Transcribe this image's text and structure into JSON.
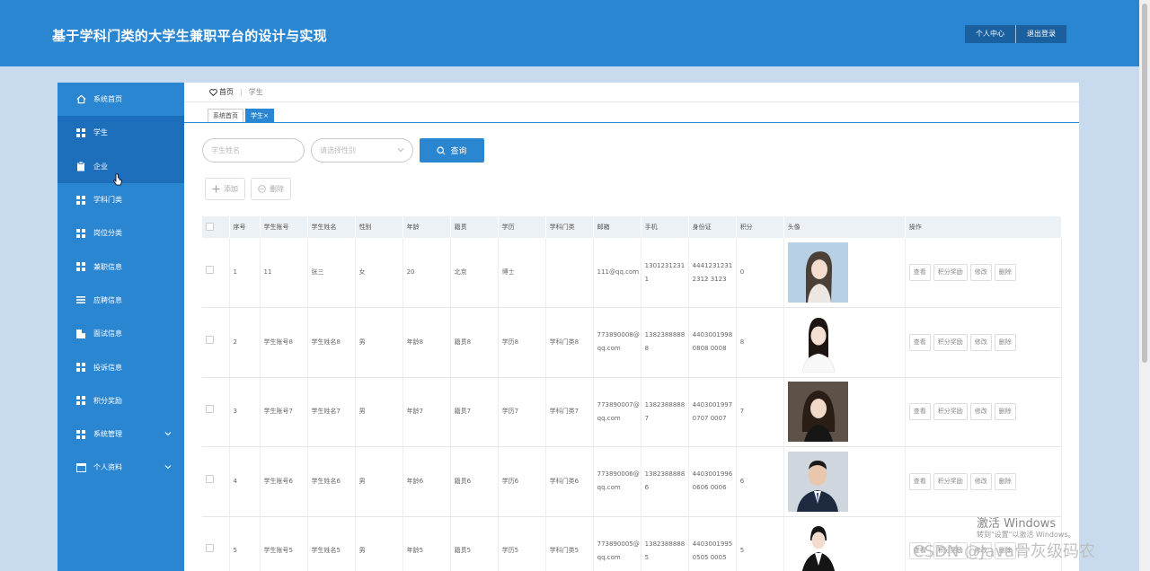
{
  "header": {
    "title": "基于学科门类的大学生兼职平台的设计与实现",
    "buttons": [
      "个人中心",
      "退出登录"
    ]
  },
  "sidebar": {
    "items": [
      {
        "label": "系统首页",
        "icon": "home-icon"
      },
      {
        "label": "学生",
        "icon": "grid-icon"
      },
      {
        "label": "企业",
        "icon": "clipboard-icon"
      },
      {
        "label": "学科门类",
        "icon": "grid-icon"
      },
      {
        "label": "岗位分类",
        "icon": "grid-icon"
      },
      {
        "label": "兼职信息",
        "icon": "grid-icon"
      },
      {
        "label": "应聘信息",
        "icon": "list-icon"
      },
      {
        "label": "面试信息",
        "icon": "note-icon"
      },
      {
        "label": "投诉信息",
        "icon": "grid-icon"
      },
      {
        "label": "积分奖励",
        "icon": "grid-icon"
      },
      {
        "label": "系统管理",
        "icon": "grid-icon",
        "expandable": true
      },
      {
        "label": "个人资料",
        "icon": "card-icon",
        "expandable": true
      }
    ],
    "accent": "#2b86d2"
  },
  "breadcrumb": {
    "home": "首页",
    "current": "学生"
  },
  "tabs": [
    {
      "label": "系统首页"
    },
    {
      "label": "学生×"
    }
  ],
  "search": {
    "name_placeholder": "学生姓名",
    "gender_placeholder": "请选择性别",
    "query_label": "查询"
  },
  "ops": {
    "add_label": "添加",
    "delete_label": "删除"
  },
  "table": {
    "columns": [
      "序号",
      "学生账号",
      "学生姓名",
      "性别",
      "年龄",
      "籍贯",
      "学历",
      "学科门类",
      "邮箱",
      "手机",
      "身份证",
      "积分",
      "头像",
      "操作"
    ],
    "actions": [
      "查看",
      "积分奖励",
      "修改",
      "删除"
    ],
    "rows": [
      {
        "no": "1",
        "account": "11",
        "name": "张三",
        "gender": "女",
        "age": "20",
        "native": "北京",
        "edu": "博士",
        "subject": "",
        "email": "111@qq.com",
        "phone": "13012312311",
        "idcard": "44412312312312 3123",
        "points": "0"
      },
      {
        "no": "2",
        "account": "学生账号8",
        "name": "学生姓名8",
        "gender": "男",
        "age": "年龄8",
        "native": "籍贯8",
        "edu": "学历8",
        "subject": "学科门类8",
        "email": "773890008@qq.com",
        "phone": "13823888888",
        "idcard": "44030019980808 0008",
        "points": "8"
      },
      {
        "no": "3",
        "account": "学生账号7",
        "name": "学生姓名7",
        "gender": "男",
        "age": "年龄7",
        "native": "籍贯7",
        "edu": "学历7",
        "subject": "学科门类7",
        "email": "773890007@qq.com",
        "phone": "13823888887",
        "idcard": "44030019970707 0007",
        "points": "7"
      },
      {
        "no": "4",
        "account": "学生账号6",
        "name": "学生姓名6",
        "gender": "男",
        "age": "年龄6",
        "native": "籍贯6",
        "edu": "学历6",
        "subject": "学科门类6",
        "email": "773890006@qq.com",
        "phone": "13823888886",
        "idcard": "44030019960606 0006",
        "points": "6"
      },
      {
        "no": "5",
        "account": "学生账号5",
        "name": "学生姓名5",
        "gender": "男",
        "age": "年龄5",
        "native": "籍贯5",
        "edu": "学历5",
        "subject": "学科门类5",
        "email": "773890005@qq.com",
        "phone": "13823888885",
        "idcard": "44030019950505 0005",
        "points": "5"
      }
    ]
  },
  "watermark": {
    "line1": "激活 Windows",
    "line2": "转到\"设置\"以激活 Windows。",
    "csdn": "CSDN @Java骨灰级码农"
  }
}
